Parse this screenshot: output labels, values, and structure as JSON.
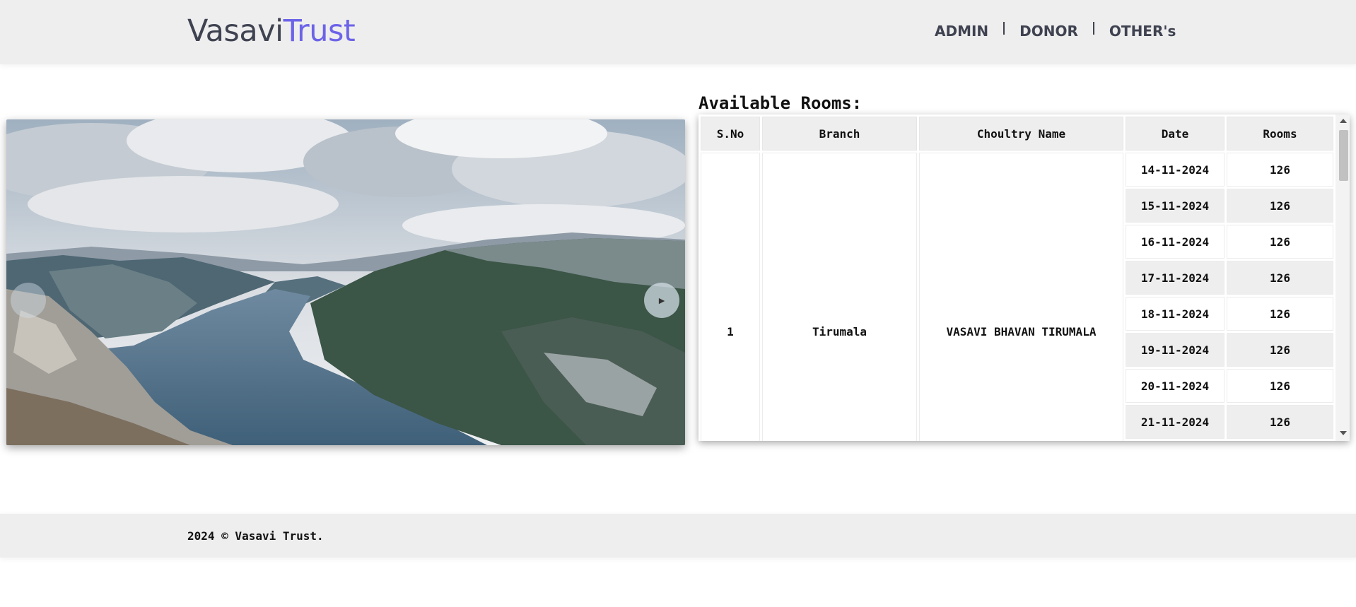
{
  "brand": {
    "part1": "Vasavi",
    "part2": "Trust",
    "accent": "#6c63e8"
  },
  "nav": {
    "items": [
      "ADMIN",
      "DONOR",
      "OTHER's"
    ]
  },
  "slider": {
    "image": "fjord-landscape",
    "prev_icon": "chevron-left-icon",
    "next_icon": "play-arrow-icon",
    "next_label": "►"
  },
  "rooms": {
    "title": "Available Rooms:",
    "headers": [
      "S.No",
      "Branch",
      "Choultry Name",
      "Date",
      "Rooms"
    ],
    "group": {
      "sno": "1",
      "branch": "Tirumala",
      "choultry": "VASAVI BHAVAN TIRUMALA"
    },
    "rows": [
      {
        "date": "14-11-2024",
        "rooms": "126"
      },
      {
        "date": "15-11-2024",
        "rooms": "126"
      },
      {
        "date": "16-11-2024",
        "rooms": "126"
      },
      {
        "date": "17-11-2024",
        "rooms": "126"
      },
      {
        "date": "18-11-2024",
        "rooms": "126"
      },
      {
        "date": "19-11-2024",
        "rooms": "126"
      },
      {
        "date": "20-11-2024",
        "rooms": "126"
      },
      {
        "date": "21-11-2024",
        "rooms": "126"
      }
    ]
  },
  "footer": {
    "text": "2024 © Vasavi Trust."
  }
}
